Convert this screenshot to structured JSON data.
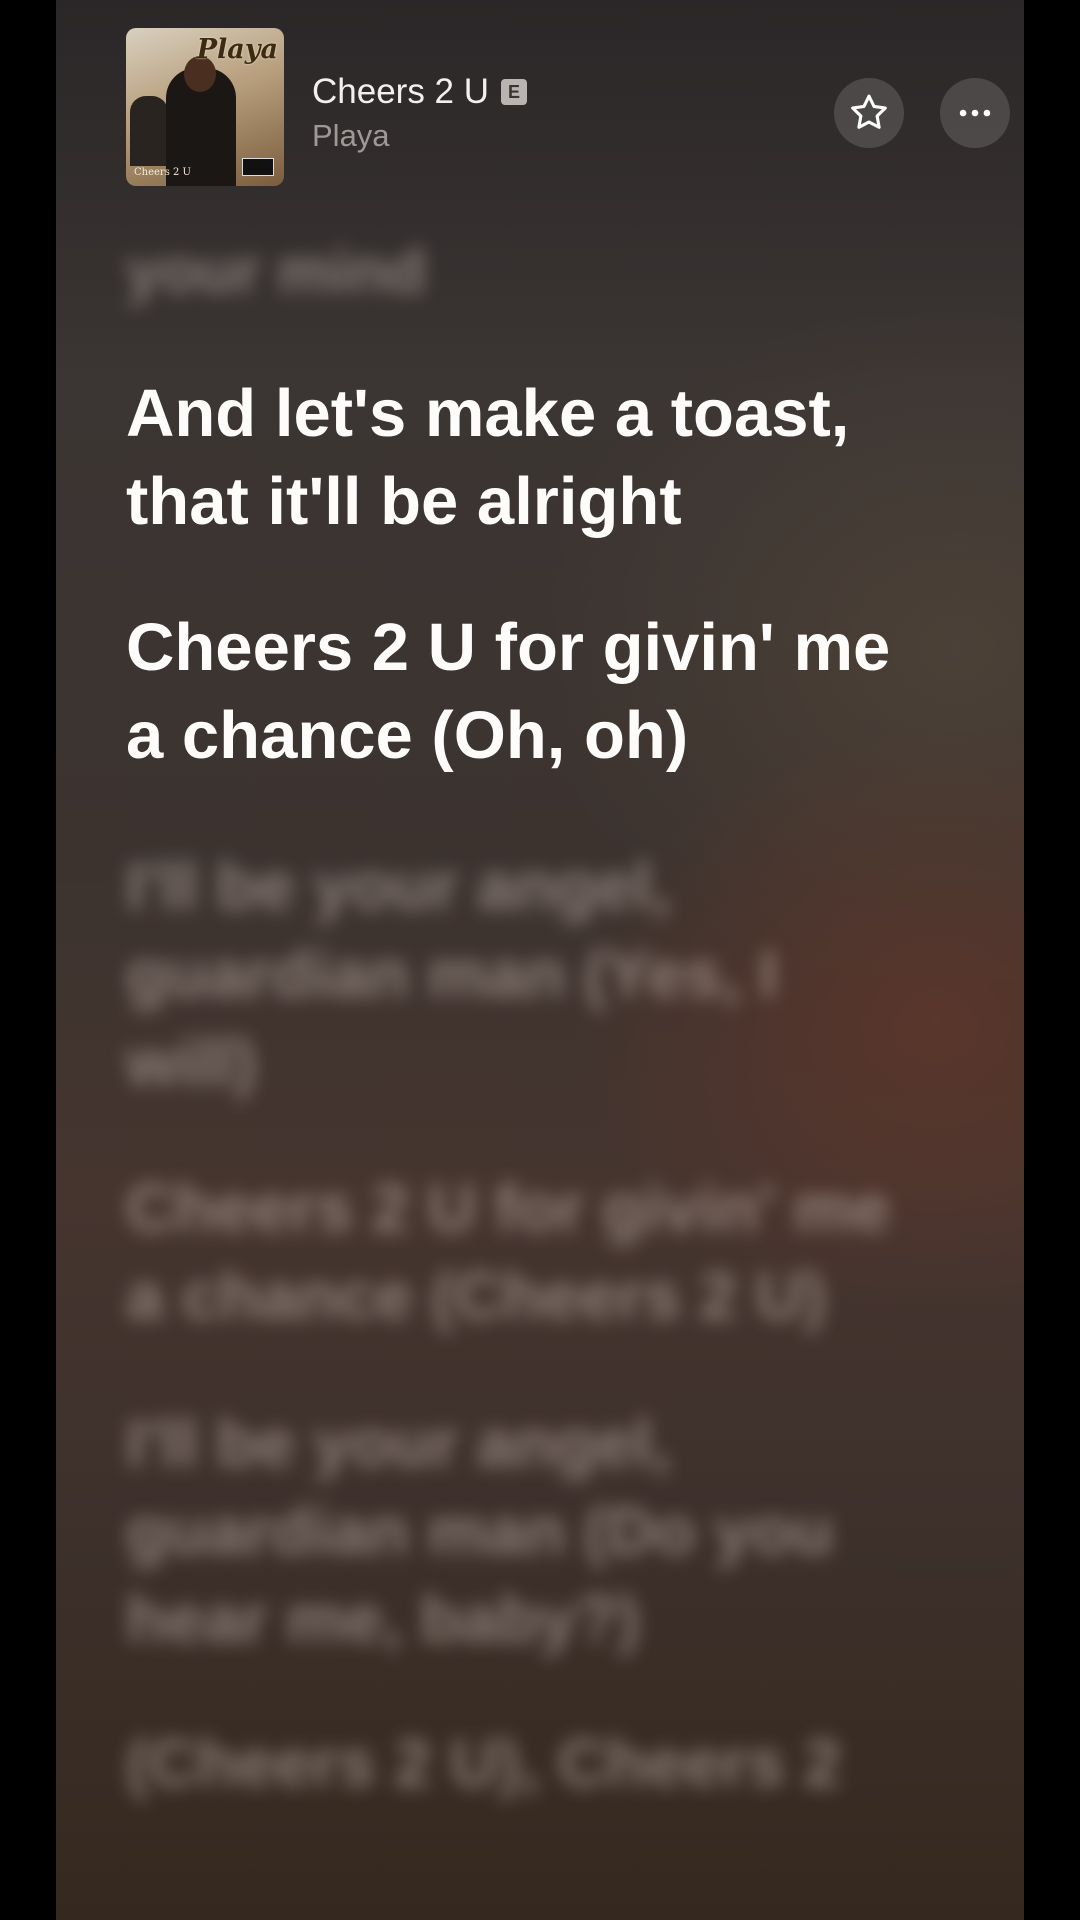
{
  "now_playing": {
    "title": "Cheers 2 U",
    "explicit_badge": "E",
    "artist": "Playa",
    "artwork": {
      "title_text": "Playa",
      "caption_text": "Cheers 2 U"
    }
  },
  "actions": {
    "favorite_icon": "star-outline-icon",
    "more_icon": "ellipsis-icon"
  },
  "lyrics": {
    "previous_line": "your mind",
    "active_lines": [
      "And let's make a toast,\nthat it'll be alright",
      "Cheers 2 U for givin' me\na chance (Oh, oh)"
    ],
    "upcoming_lines": [
      "I'll be your angel,\nguardian man (Yes, I\nwill)",
      "Cheers 2 U for givin' me\na chance (Cheers 2 U)",
      "I'll be your angel,\nguardian man (Do you\nhear me, baby?)",
      "(Cheers 2 U), Cheers 2"
    ]
  },
  "colors": {
    "active_lyric": "#fdfcfa",
    "inactive_lyric": "#c8b9b2",
    "background": "#3c332f"
  }
}
